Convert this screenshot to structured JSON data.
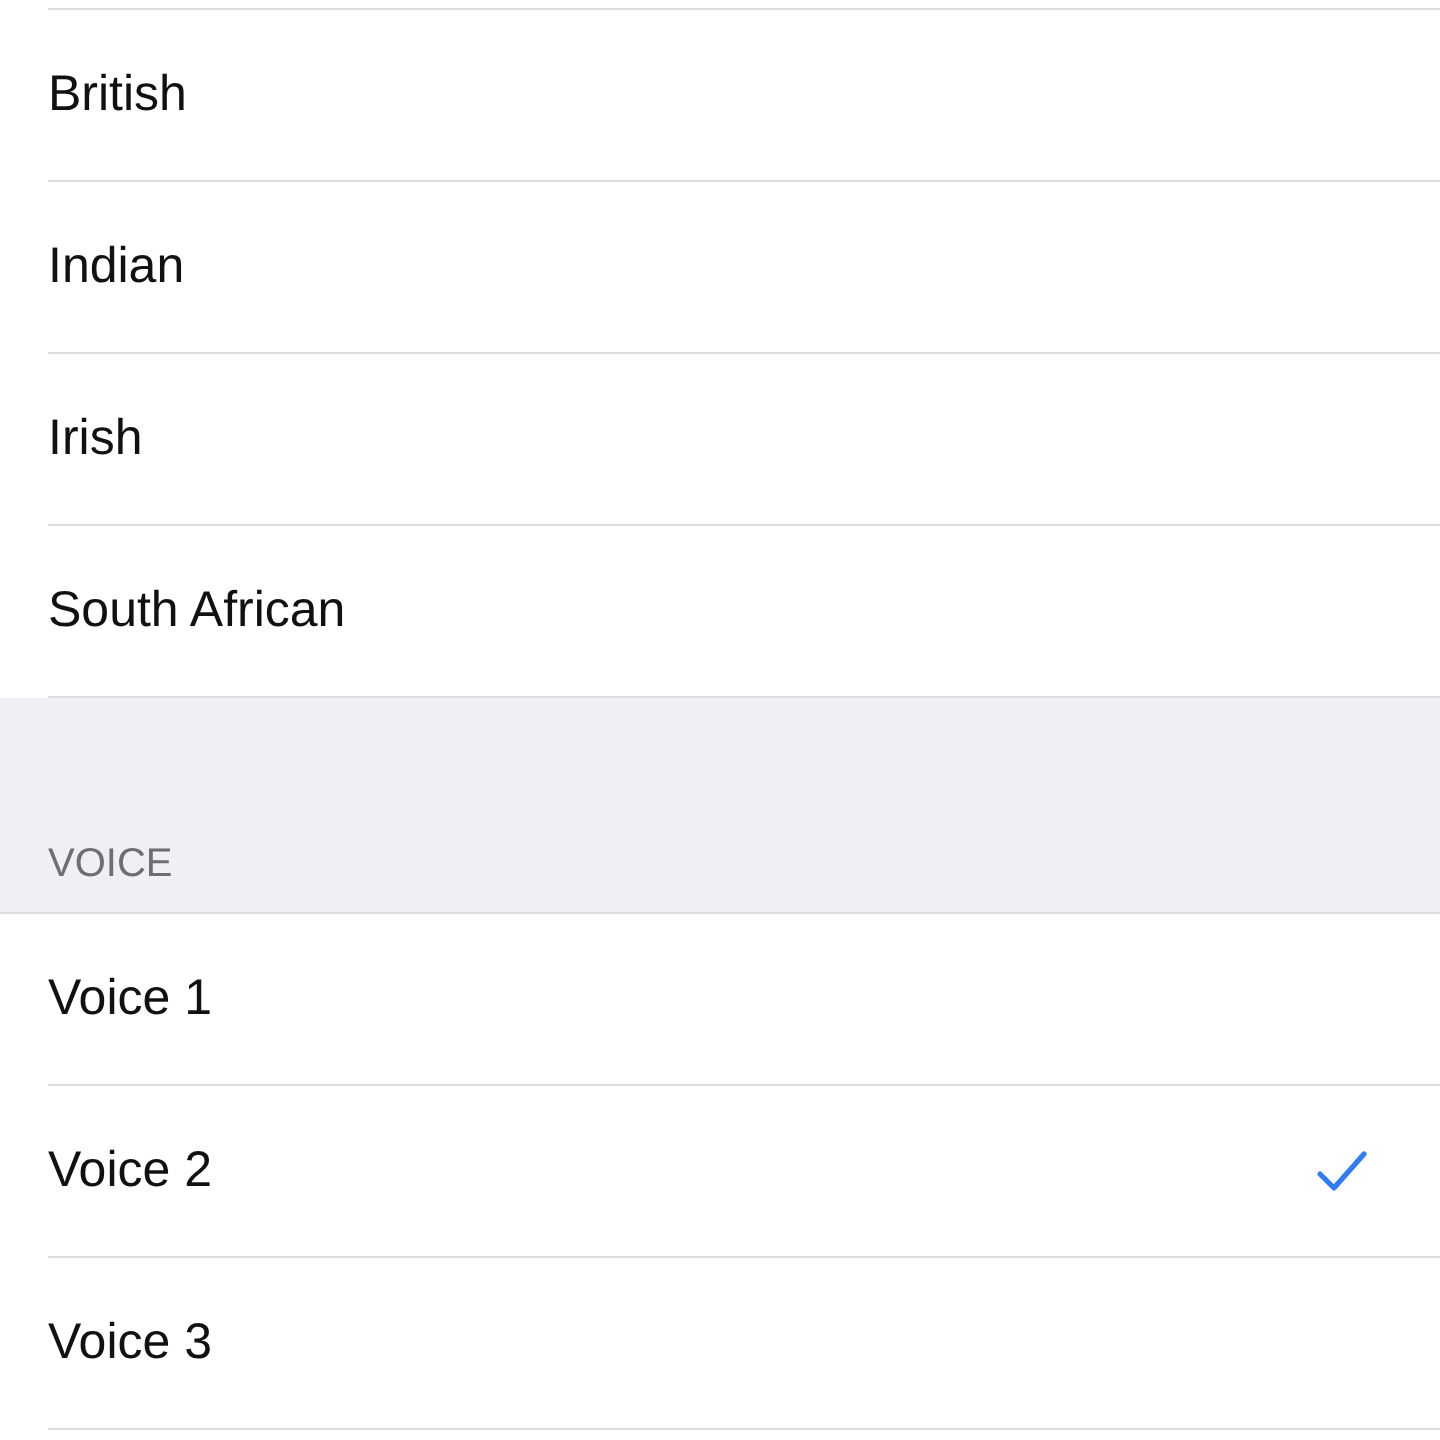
{
  "accent_options": [
    {
      "label": "British"
    },
    {
      "label": "Indian"
    },
    {
      "label": "Irish"
    },
    {
      "label": "South African"
    }
  ],
  "voice_section": {
    "header": "VOICE",
    "items": [
      {
        "label": "Voice 1",
        "selected": false
      },
      {
        "label": "Voice 2",
        "selected": true
      },
      {
        "label": "Voice 3",
        "selected": false
      }
    ]
  }
}
